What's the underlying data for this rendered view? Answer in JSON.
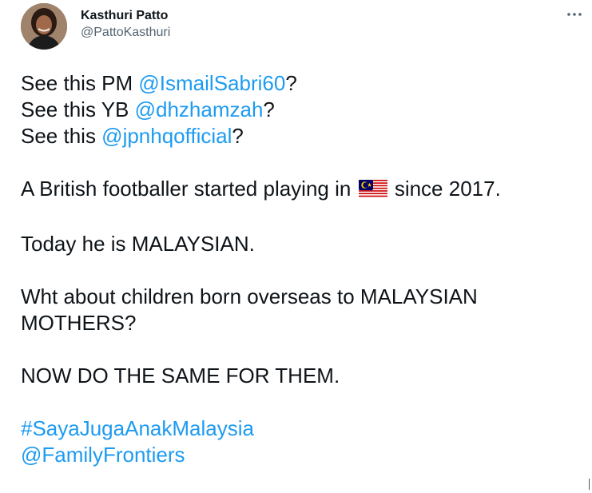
{
  "author": {
    "display_name": "Kasthuri Patto",
    "handle": "@PattoKasthuri"
  },
  "tweet": {
    "line1_prefix": "See this PM ",
    "line1_mention": "@IsmailSabri60",
    "line1_suffix": "?",
    "line2_prefix": "See this YB ",
    "line2_mention": "@dhzhamzah",
    "line2_suffix": "?",
    "line3_prefix": "See this ",
    "line3_mention": "@jpnhqofficial",
    "line3_suffix": "?",
    "line4_prefix": "A British footballer started playing in",
    "line4_suffix": "since 2017.",
    "line5": "Today he is MALAYSIAN.",
    "line6": "Wht about children born overseas to MALAYSIAN",
    "line7": "MOTHERS?",
    "line8": "NOW DO THE SAME FOR THEM.",
    "hashtag": "#SayaJugaAnakMalaysia",
    "mention_footer": "@FamilyFrontiers"
  },
  "colors": {
    "text": "#0f1419",
    "link": "#1d9bf0",
    "secondary": "#536471"
  },
  "icons": {
    "more": "more-horizontal-icon",
    "flag": "malaysia-flag-icon"
  }
}
